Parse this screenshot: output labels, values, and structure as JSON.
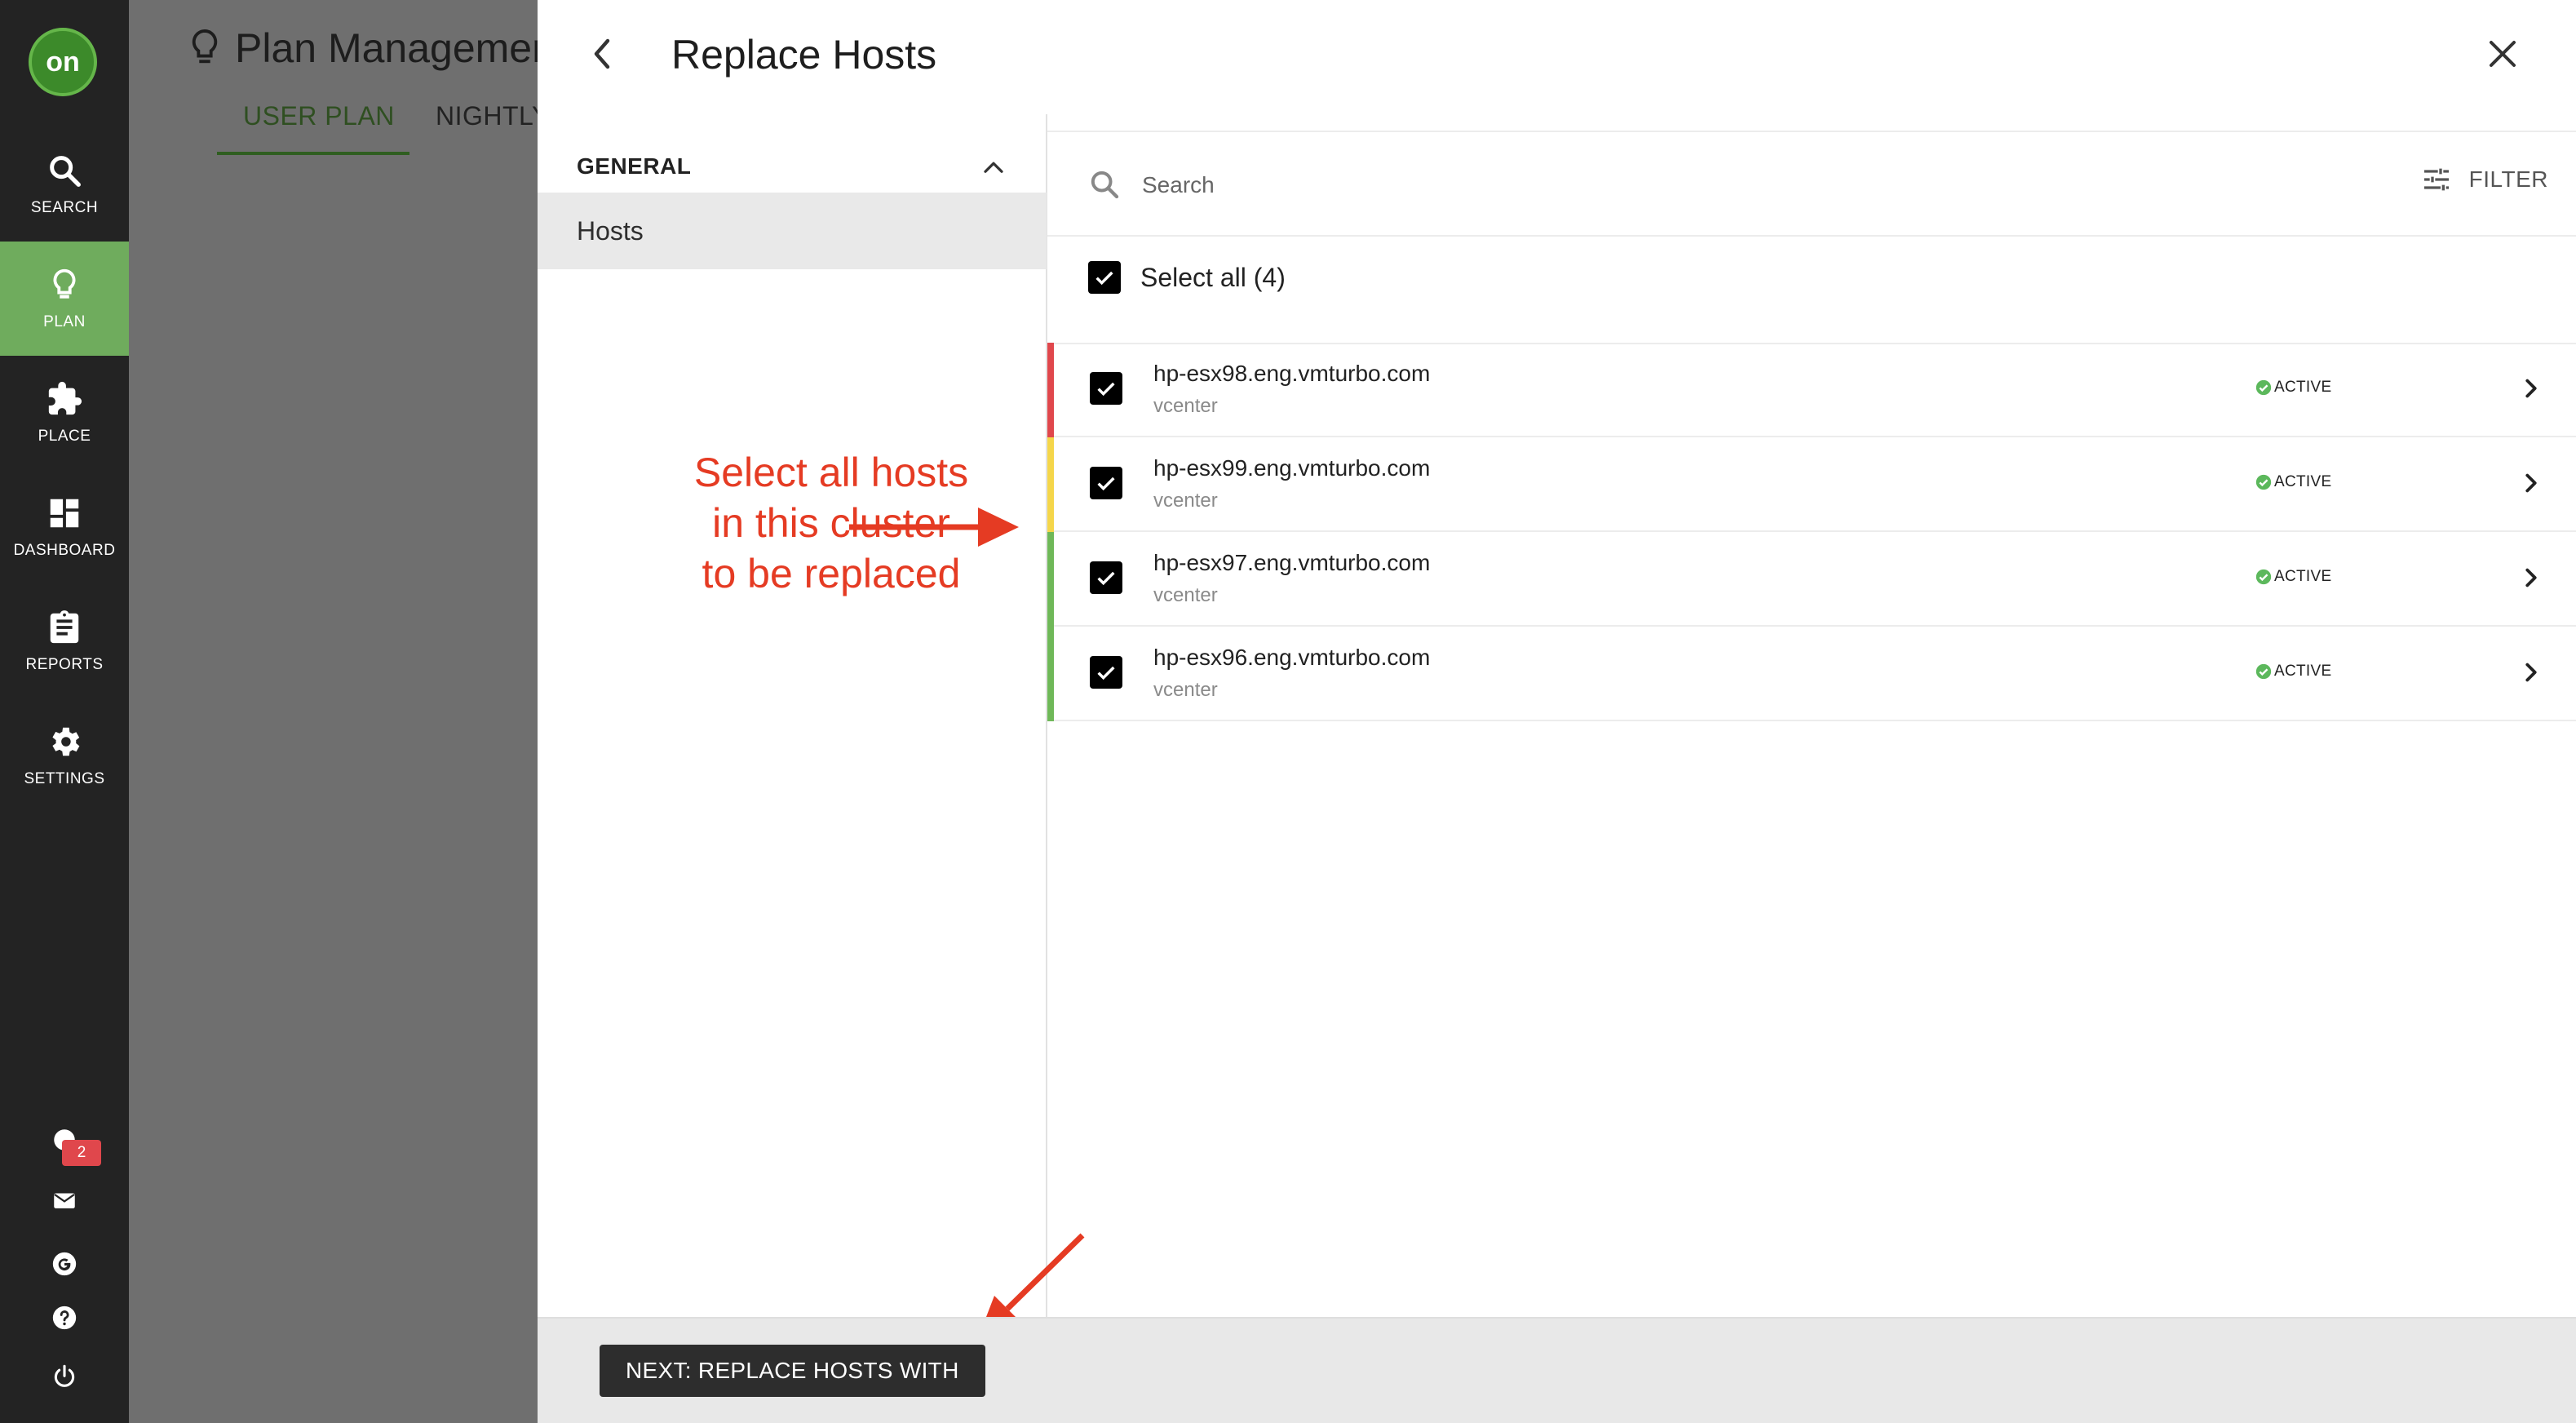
{
  "nav": {
    "logo_text": "on",
    "items": [
      {
        "label": "SEARCH",
        "icon": "search-icon"
      },
      {
        "label": "PLAN",
        "icon": "lightbulb-icon",
        "active": true
      },
      {
        "label": "PLACE",
        "icon": "puzzle-icon"
      },
      {
        "label": "DASHBOARD",
        "icon": "dashboard-icon"
      },
      {
        "label": "REPORTS",
        "icon": "clipboard-icon"
      },
      {
        "label": "SETTINGS",
        "icon": "gear-icon"
      }
    ],
    "notification_count": "2"
  },
  "background_page": {
    "title": "Plan Managemen",
    "tabs": [
      "USER PLAN",
      "NIGHTLY"
    ]
  },
  "panel": {
    "title": "Replace Hosts",
    "section_header": "GENERAL",
    "section_item": "Hosts",
    "search_placeholder": "Search",
    "filter_label": "FILTER",
    "select_all_label": "Select all (4)",
    "hosts": [
      {
        "name": "hp-esx98.eng.vmturbo.com",
        "source": "vcenter",
        "status": "ACTIVE",
        "severity_color": "#e0474c",
        "checked": true
      },
      {
        "name": "hp-esx99.eng.vmturbo.com",
        "source": "vcenter",
        "status": "ACTIVE",
        "severity_color": "#f5d64a",
        "checked": true
      },
      {
        "name": "hp-esx97.eng.vmturbo.com",
        "source": "vcenter",
        "status": "ACTIVE",
        "severity_color": "#6fb858",
        "checked": true
      },
      {
        "name": "hp-esx96.eng.vmturbo.com",
        "source": "vcenter",
        "status": "ACTIVE",
        "severity_color": "#6fb858",
        "checked": true
      }
    ],
    "next_button": "NEXT: REPLACE HOSTS WITH"
  },
  "annotation": {
    "text": "Select all hosts\nin this cluster\nto be replaced",
    "color": "#e53b23"
  },
  "colors": {
    "nav_bg": "#232323",
    "nav_active": "#6fac5d",
    "status_ok": "#5cb85c"
  }
}
